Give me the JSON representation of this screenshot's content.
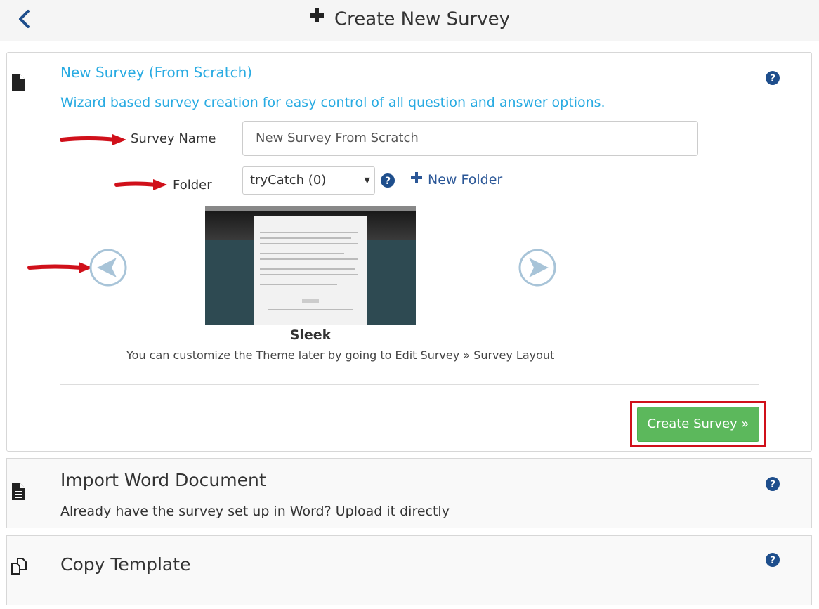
{
  "header": {
    "title": "Create New Survey"
  },
  "scratch": {
    "heading": "New Survey (From Scratch)",
    "subheading": "Wizard based survey creation for easy control of all question and answer options.",
    "survey_name_label": "Survey Name",
    "survey_name_value": "New Survey From Scratch",
    "folder_label": "Folder",
    "folder_selected": "tryCatch (0)",
    "new_folder_label": "New Folder",
    "theme": {
      "name": "Sleek",
      "hint": "You can customize the Theme later by going to Edit Survey » Survey Layout"
    },
    "create_button": "Create Survey »"
  },
  "word_import": {
    "title": "Import Word Document",
    "description": "Already have the survey set up in Word? Upload it directly"
  },
  "copy_template": {
    "title": "Copy Template"
  },
  "colors": {
    "link_blue": "#29abe2",
    "navy": "#2b5797",
    "success_green": "#5cb85c",
    "highlight_red": "#d0101a"
  }
}
